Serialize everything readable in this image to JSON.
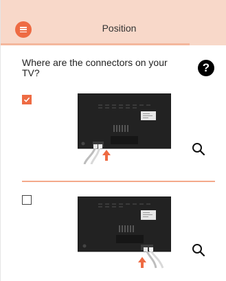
{
  "header": {
    "title": "Position",
    "menu_icon": "hamburger-menu-icon",
    "accent_color": "#ee6b43",
    "background_color": "#f8d8c9"
  },
  "question": {
    "text": "Where are the connectors on your TV?",
    "help_icon": "question-mark-icon"
  },
  "options": [
    {
      "position": "bottom-left connectors",
      "selected": true,
      "zoom_icon": "magnifier-icon"
    },
    {
      "position": "bottom-right connectors",
      "selected": false,
      "zoom_icon": "magnifier-icon"
    }
  ],
  "help_glyph": "?"
}
